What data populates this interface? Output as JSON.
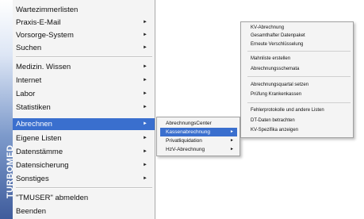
{
  "brand": "TURBOMED",
  "main_menu": {
    "items": [
      {
        "label": "Wartezimmerlisten",
        "arrow": ""
      },
      {
        "label": "Praxis-E-Mail",
        "arrow": "►"
      },
      {
        "label": "Vorsorge-System",
        "arrow": "►"
      },
      {
        "label": "Suchen",
        "arrow": "►"
      },
      {
        "label": "Medizin. Wissen",
        "arrow": "►"
      },
      {
        "label": "Internet",
        "arrow": "►"
      },
      {
        "label": "Labor",
        "arrow": "►"
      },
      {
        "label": "Statistiken",
        "arrow": "►"
      },
      {
        "label": "Abrechnen",
        "arrow": "►"
      },
      {
        "label": "Eigene Listen",
        "arrow": "►"
      },
      {
        "label": "Datenstämme",
        "arrow": "►"
      },
      {
        "label": "Datensicherung",
        "arrow": "►"
      },
      {
        "label": "Sonstiges",
        "arrow": "►"
      },
      {
        "label": "\"TMUSER\" abmelden",
        "arrow": ""
      },
      {
        "label": "Beenden",
        "arrow": ""
      }
    ]
  },
  "abrechnen_submenu": {
    "items": [
      {
        "label": "AbrechnungsCenter",
        "arrow": ""
      },
      {
        "label": "Kassenabrechnung",
        "arrow": "►"
      },
      {
        "label": "Privatliquidation",
        "arrow": "►"
      },
      {
        "label": "HzV-Abrechnung",
        "arrow": "►"
      }
    ]
  },
  "kassen_flyout": {
    "items": [
      {
        "label": "KV-Abrechnung"
      },
      {
        "label": "Gesamthafter Datenpaket"
      },
      {
        "label": "Erneute Verschlüsselung"
      },
      {
        "label": "Mahnliste erstellen"
      },
      {
        "label": "Abrechnungsschemata"
      },
      {
        "label": "Abrechnungsquartal setzen"
      },
      {
        "label": "Prüfung Krankenkassen"
      },
      {
        "label": "Fehlerprotokolle und andere Listen"
      },
      {
        "label": "DT-Daten betrachten"
      },
      {
        "label": "KV-Spezifika anzeigen"
      }
    ]
  }
}
